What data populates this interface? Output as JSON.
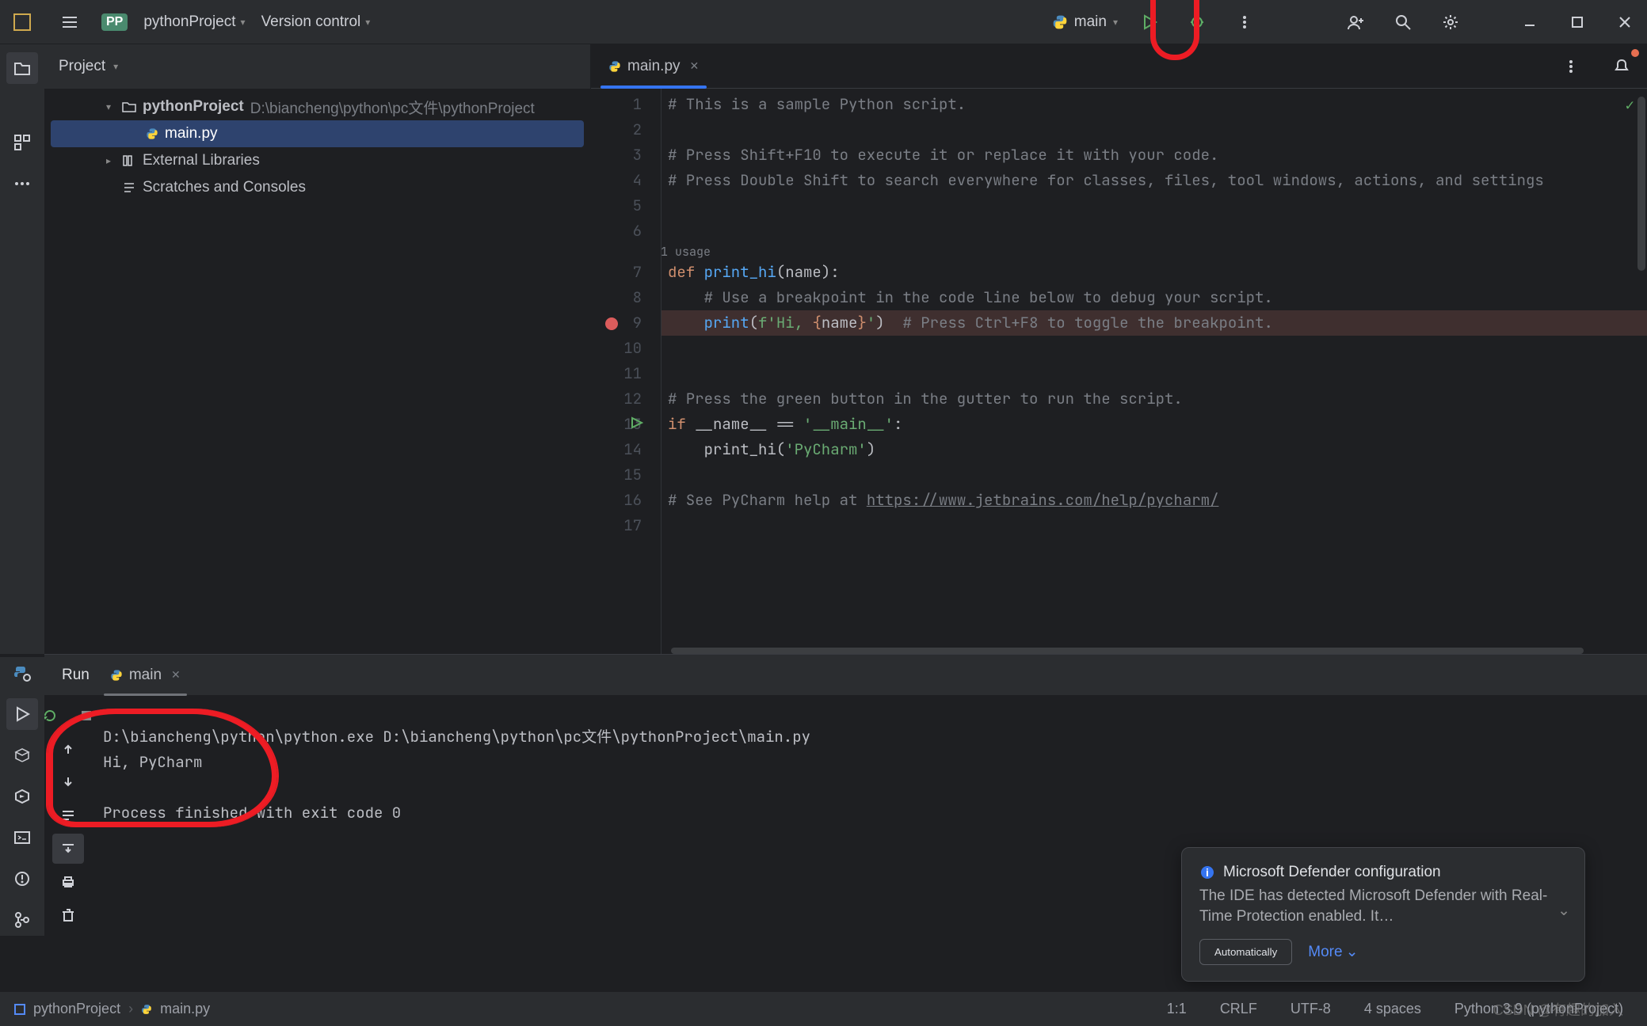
{
  "titlebar": {
    "project_name": "pythonProject",
    "vcs_label": "Version control",
    "run_config": "main"
  },
  "project_panel": {
    "header": "Project",
    "root_name": "pythonProject",
    "root_path": "D:\\biancheng\\python\\pc文件\\pythonProject",
    "file_main": "main.py",
    "external_libs": "External Libraries",
    "scratches": "Scratches and Consoles"
  },
  "editor": {
    "tab_name": "main.py",
    "usage_hint": "1 usage",
    "lines": {
      "l1": "# This is a sample Python script.",
      "l3": "# Press Shift+F10 to execute it or replace it with your code.",
      "l4": "# Press Double Shift to search everywhere for classes, files, tool windows, actions, and settings",
      "l7_def": "def ",
      "l7_fn": "print_hi",
      "l7_rest": "(name):",
      "l8": "    # Use a breakpoint in the code line below to debug your script.",
      "l9_indent": "    ",
      "l9_print": "print",
      "l9_open": "(",
      "l9_f": "f'Hi, ",
      "l9_br_open": "{",
      "l9_name": "name",
      "l9_br_close": "}",
      "l9_close": "'",
      "l9_paren": ")",
      "l9_cmt": "  # Press Ctrl+F8 to toggle the breakpoint.",
      "l12": "# Press the green button in the gutter to run the script.",
      "l13_if": "if ",
      "l13_name": "__name__ == ",
      "l13_str": "'__main__'",
      "l13_colon": ":",
      "l14_indent": "    print_hi(",
      "l14_str": "'PyCharm'",
      "l14_close": ")",
      "l16_pre": "# See PyCharm help at ",
      "l16_url": "https://www.jetbrains.com/help/pycharm/"
    }
  },
  "run": {
    "panel_label": "Run",
    "tab_name": "main",
    "output_cmd": "D:\\biancheng\\python\\python.exe D:\\biancheng\\python\\pc文件\\pythonProject\\main.py",
    "output_hi": "Hi, PyCharm",
    "output_exit": "Process finished with exit code 0"
  },
  "notification": {
    "title": "Microsoft Defender configuration",
    "body": "The IDE has detected Microsoft Defender with Real-Time Protection enabled. It…",
    "btn": "Automatically",
    "more": "More"
  },
  "statusbar": {
    "crumb1": "pythonProject",
    "crumb2": "main.py",
    "pos": "1:1",
    "le": "CRLF",
    "enc": "UTF-8",
    "indent": "4 spaces",
    "interp": "Python 3.9 (pythonProject)",
    "watermark": "CSDN @有趣的加入"
  }
}
